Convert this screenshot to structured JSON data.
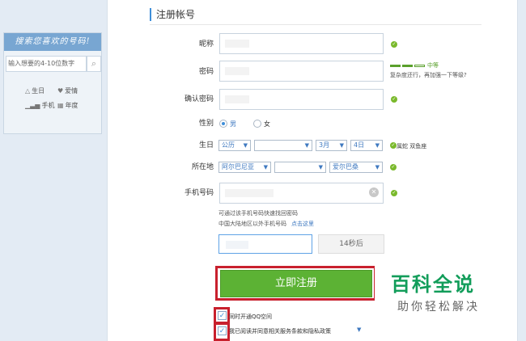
{
  "sidebar": {
    "title": "搜索您喜欢的号码!",
    "search_placeholder": "输入想要的4-10位数字",
    "links": [
      {
        "label": "生日",
        "icon": "birthday-icon"
      },
      {
        "label": "爱情",
        "icon": "heart-icon"
      },
      {
        "label": "手机",
        "icon": "signal-icon"
      },
      {
        "label": "年度",
        "icon": "calendar-icon"
      }
    ]
  },
  "form": {
    "heading": "注册帐号",
    "nickname_label": "昵称",
    "password_label": "密码",
    "password_strength": "中等",
    "password_hint": "复杂度还行，再加强一下等级?",
    "confirm_label": "确认密码",
    "gender_label": "性别",
    "gender_male": "男",
    "gender_female": "女",
    "birthday_label": "生日",
    "birthday_calendar": "公历",
    "birthday_year": "",
    "birthday_month": "3月",
    "birthday_day": "4日",
    "zodiac": "属蛇  双鱼座",
    "location_label": "所在地",
    "location_country": "阿尔巴尼亚",
    "location_region": "",
    "location_city": "爱尔巴桑",
    "phone_label": "手机号码",
    "phone_note_1": "可通过该手机号码快速找回密码",
    "phone_note_2": "中国大陆地区以外手机号码",
    "phone_note_link": "点击这里",
    "countdown": "14秒后",
    "submit": "立即注册",
    "checkbox_qzone": "同时开通QQ空间",
    "checkbox_terms": "我已阅读并同意相关服务条款和隐私政策"
  },
  "watermark": {
    "title": "百科全说",
    "subtitle": "助你轻松解决"
  },
  "colors": {
    "accent": "#3f8fd9",
    "submit_green": "#5cb234",
    "ok_green": "#7ab92c",
    "highlight_red": "#c8202d",
    "watermark_green": "#129d5a"
  }
}
